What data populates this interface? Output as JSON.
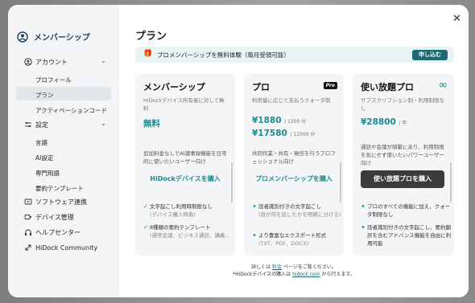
{
  "colors": {
    "accent": "#1e8a8e",
    "brand": "#1f3d5c",
    "promo_bg": "#e8f3f4",
    "dark_button": "#3b3b3b"
  },
  "sidebar": {
    "title": "メンバーシップ",
    "title_icon": "account-circle-icon",
    "account": {
      "label": "アカウント",
      "icon": "person-icon",
      "children": [
        "プロフィール",
        "プラン",
        "アクティベーションコード"
      ]
    },
    "settings": {
      "label": "設定",
      "icon": "sliders-icon",
      "children": [
        "言語",
        "AI設定",
        "専門用語",
        "要約テンプレート"
      ]
    },
    "items": [
      {
        "label": "ソフトウェア連携",
        "icon": "integration-icon"
      },
      {
        "label": "デバイス管理",
        "icon": "device-icon"
      },
      {
        "label": "ヘルプセンター",
        "icon": "help-icon"
      },
      {
        "label": "HiDock Community",
        "icon": "community-icon"
      }
    ]
  },
  "main": {
    "title": "プラン",
    "promo": {
      "text": "プロメンバーシップを無料体験（毎月受領可能）",
      "button": "申し込む"
    },
    "cards": [
      {
        "name": "メンバーシップ",
        "desc": "HiDockデバイス所有者に対して無料",
        "price": "無料",
        "note": "追加料金なしでAI議事録機能を日常的に使いたいユーザー向け",
        "cta": "HiDockデバイスを購入",
        "features": [
          {
            "text": "文字起こし利用時制限なし",
            "sub": "(デバイス購入特典)"
          },
          {
            "text": "8種類の要約テンプレート",
            "sub": "(通常会議、ビジネス通話、講義…"
          }
        ]
      },
      {
        "name": "プロ",
        "badge": "Pro",
        "desc": "利用量に応じて支払うクォータ制",
        "price1": "¥1880",
        "unit1": "/ 1200 分",
        "price2": "¥17580",
        "unit2": "/ 12000 分",
        "note": "共同作業・共有・発信を行うプロフェッショナル向け",
        "cta": "プロメンバーシップを購入",
        "features": [
          {
            "text": "話者識別付きの文字起こし",
            "sub": "(誰が何を話したかを明確に分ける)"
          },
          {
            "text": "より豊富なエクスポート形式",
            "sub": "(TXT、PDF、DOCX)"
          }
        ]
      },
      {
        "name": "使い放題プロ",
        "desc": "サブスクリプション制・利用制限なし",
        "price": "¥28800",
        "unit": "/ 年",
        "note": "通話や会議が頻繁にあり、利用制限を気にせず使いたいパワーユーザー向け",
        "cta": "使い放題プロを購入",
        "features": [
          {
            "text": "プロのすべての機能に加え、クォータ制限なし"
          },
          {
            "text": "話者識別付きの文字起こし、要約翻訳を含むアドバンス機能を自由に利用可能"
          }
        ]
      }
    ],
    "footer": {
      "line1a": "詳しくは",
      "line1link": "料金",
      "line1b": "ページをご覧ください。",
      "line2a": "*HiDockデバイスの購入は",
      "line2link": "hidock.com",
      "line2b": "から行えます。"
    },
    "close_icon": "close-icon"
  }
}
